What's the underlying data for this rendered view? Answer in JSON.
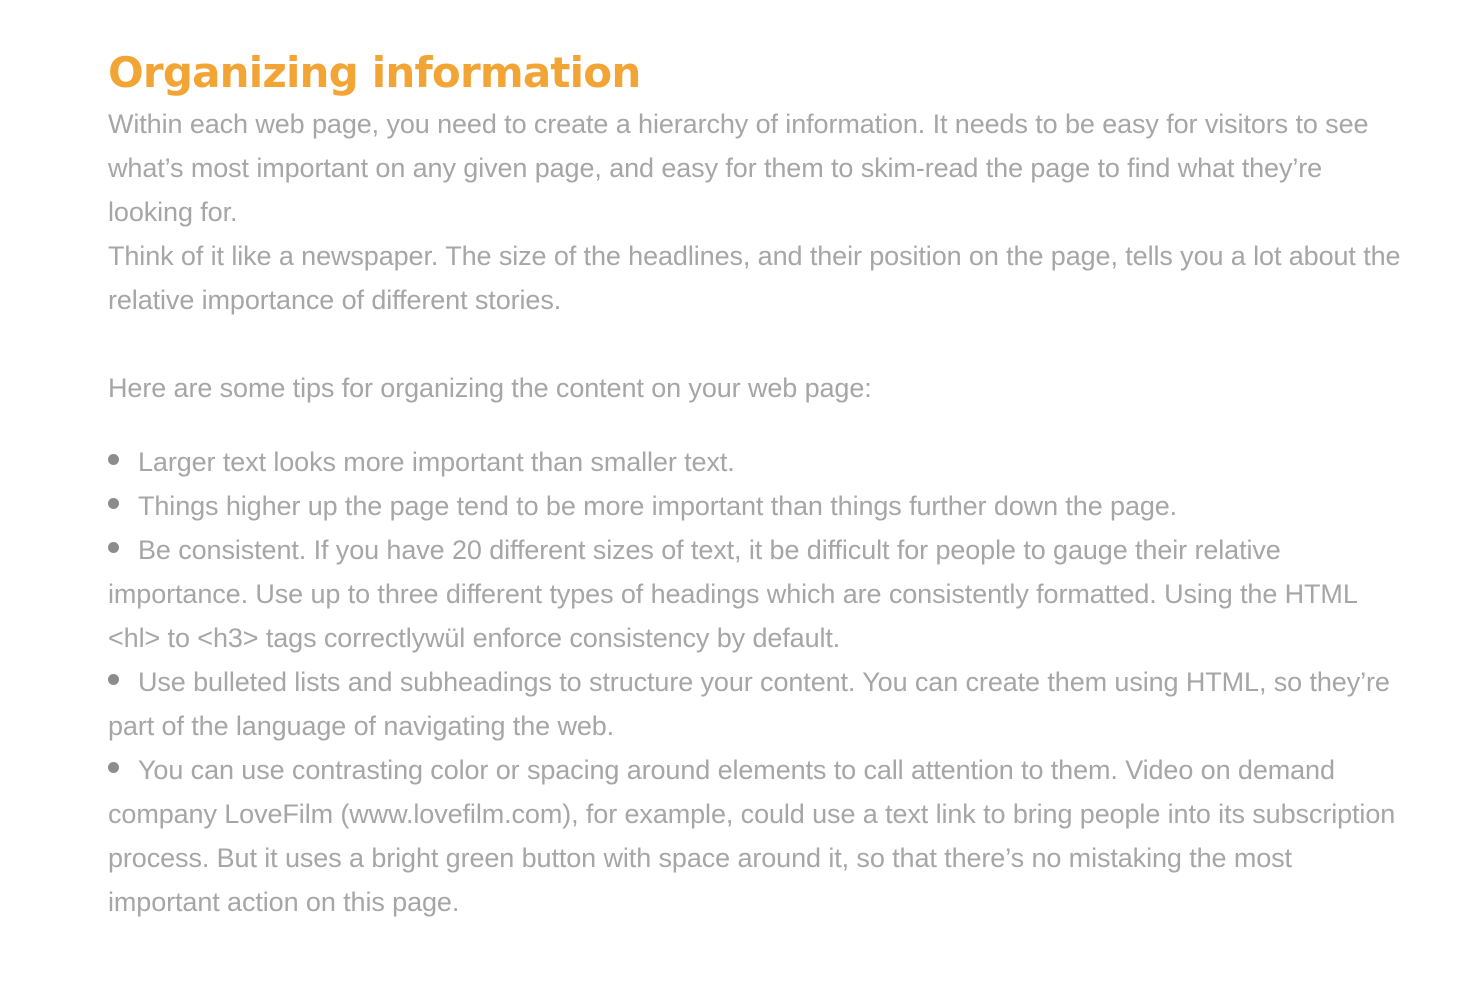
{
  "heading": "Organizing information",
  "colors": {
    "heading": "#f2a535",
    "text": "#a6a6a6",
    "bullet": "#8c8c8c"
  },
  "paragraphs": [
    "Within each web page, you need to create a hierarchy of information. It needs to be easy for visitors to see what’s most important on any given page, and easy for them to skim-read the page to find what they’re looking for.",
    "Think of it like a newspaper. The size of the headlines, and their position on the page, tells you a lot about the relative importance of different stories.",
    "Here are some tips for organizing the content on your web page:"
  ],
  "tips": [
    "Larger text looks more important than smaller text.",
    "Things higher up the page tend to be more important than things further down the page.",
    "Be consistent. If you have 20 different sizes of text, it be difficult for people to gauge their relative importance. Use up to three different types of headings which are consistently formatted. Using the HTML <hl> to <h3> tags correctlywül enforce consistency by default.",
    "Use bulleted lists and subheadings to structure your content. You can create them using HTML, so they’re part of the language of navigating the web.",
    "You can use contrasting color or spacing around elements to call attention to them. Video on demand company LoveFilm (www.lovefilm.com), for example, could use a text link to bring people into its subscription process. But it uses a bright green button with space around it, so that there’s no mistaking the most important action on this page."
  ]
}
